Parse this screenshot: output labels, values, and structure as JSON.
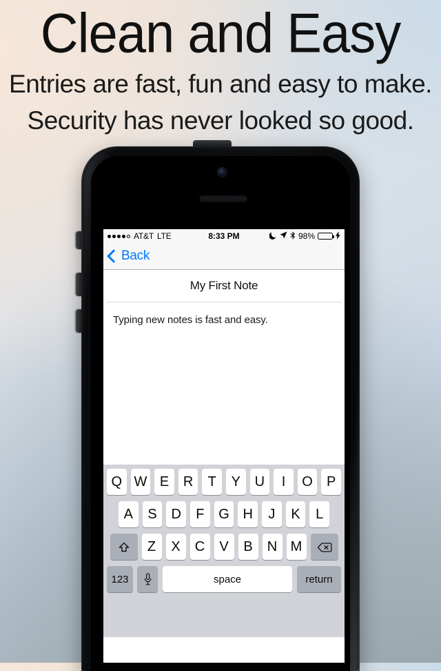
{
  "promo": {
    "headline": "Clean and Easy",
    "subline_1": "Entries are fast, fun and easy to make.",
    "subline_2": "Security has never looked so good."
  },
  "colors": {
    "accent_blue": "#007aff",
    "battery_green": "#4cd964",
    "keyboard_bg": "#d1d3d9",
    "key_white": "#ffffff",
    "key_gray": "#a9aeb7"
  },
  "status_bar": {
    "signal_dots_filled": 4,
    "signal_dots_total": 5,
    "carrier": "AT&T",
    "network": "LTE",
    "time": "8:33 PM",
    "do_not_disturb_icon": "moon-icon",
    "location_icon": "location-arrow-icon",
    "bluetooth_icon": "bluetooth-icon",
    "battery_percent": "98%",
    "battery_level": 98,
    "charging": true
  },
  "nav_bar": {
    "back_label": "Back"
  },
  "note": {
    "title": "My First Note",
    "body": "Typing new notes is fast and easy."
  },
  "keyboard": {
    "row1": [
      "Q",
      "W",
      "E",
      "R",
      "T",
      "Y",
      "U",
      "I",
      "O",
      "P"
    ],
    "row2": [
      "A",
      "S",
      "D",
      "F",
      "G",
      "H",
      "J",
      "K",
      "L"
    ],
    "row3": [
      "Z",
      "X",
      "C",
      "V",
      "B",
      "N",
      "M"
    ],
    "shift_label": "shift-icon",
    "backspace_label": "backspace-icon",
    "numeric_label": "123",
    "dictation_label": "microphone-icon",
    "space_label": "space",
    "return_label": "return"
  }
}
